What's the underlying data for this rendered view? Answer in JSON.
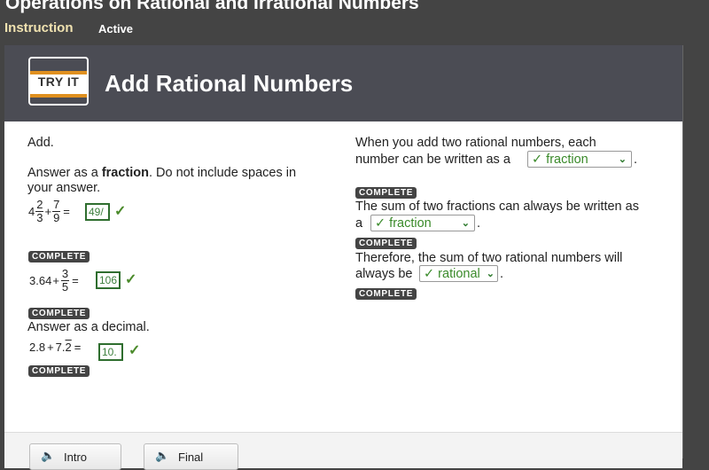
{
  "window": {
    "title": "Operations on Rational and Irrational Numbers",
    "nav": {
      "instruction": "Instruction",
      "active": "Active"
    }
  },
  "header": {
    "logo_text": "TRY IT",
    "title": "Add Rational Numbers"
  },
  "left": {
    "intro": "Add.",
    "instruction_prefix": "Answer as a ",
    "instruction_bold": "fraction",
    "instruction_suffix": ". Do not include spaces in",
    "instruction_line2": "your answer.",
    "problems": [
      {
        "whole": "4",
        "num1": "2",
        "den1": "3",
        "op": "+",
        "num2": "7",
        "den2": "9",
        "eq": "=",
        "answer": "49/",
        "status": "COMPLETE"
      },
      {
        "lhs": "3.64",
        "op": "+",
        "num": "3",
        "den": "5",
        "eq": "=",
        "answer": "106",
        "status": "COMPLETE"
      },
      {
        "note": "Answer as a decimal.",
        "lhs": "2.8",
        "op": "+",
        "rhs_int": "7.",
        "rhs_rep": "2",
        "eq": "=",
        "answer": "10.",
        "status": "COMPLETE"
      }
    ],
    "check": "✓"
  },
  "right": {
    "q1_line1": "When you add two rational numbers, each",
    "q1_line2": "number can be written as a",
    "q1_selected": "✓ fraction",
    "q1_status": "COMPLETE",
    "q2_line1": "The sum of two fractions can always  be written as",
    "q2_line2": "a",
    "q2_selected": "✓ fraction",
    "q2_status": "COMPLETE",
    "q3_line1": "Therefore, the  sum of two rational numbers will",
    "q3_line2": "always be",
    "q3_selected": "✓ rational",
    "q3_status": "COMPLETE",
    "period": ".",
    "chevron": "⌄"
  },
  "footer": {
    "intro_label": "Intro",
    "final_label": "Final",
    "speaker_icon": "🔈"
  },
  "colors": {
    "header_bg": "#4b4c54",
    "page_bg": "#444444",
    "nav_instruction": "#f0e2b0",
    "correct_green": "#3c7f3c",
    "logo_stripe": "#e0901f"
  }
}
